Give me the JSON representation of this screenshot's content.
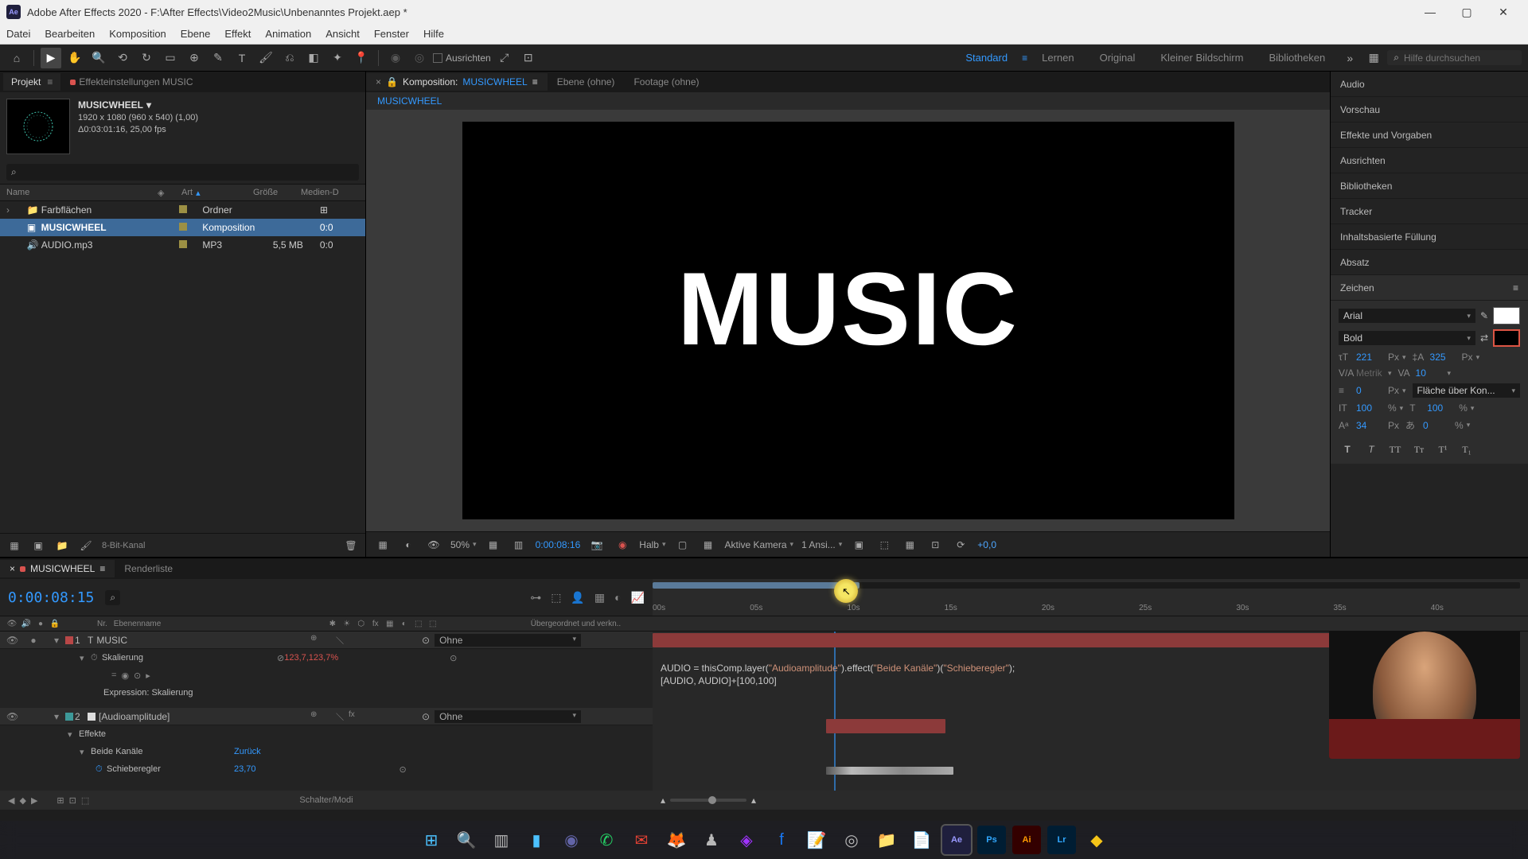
{
  "titlebar": {
    "title": "Adobe After Effects 2020 - F:\\After Effects\\Video2Music\\Unbenanntes Projekt.aep *"
  },
  "menubar": [
    "Datei",
    "Bearbeiten",
    "Komposition",
    "Ebene",
    "Effekt",
    "Animation",
    "Ansicht",
    "Fenster",
    "Hilfe"
  ],
  "toolbar": {
    "align_label": "Ausrichten",
    "workspaces": [
      "Standard",
      "Lernen",
      "Original",
      "Kleiner Bildschirm",
      "Bibliotheken"
    ],
    "search_placeholder": "Hilfe durchsuchen"
  },
  "project_panel": {
    "tab_project": "Projekt",
    "tab_effect": "Effekteinstellungen MUSIC",
    "comp_name": "MUSICWHEEL",
    "dims": "1920 x 1080 (960 x 540) (1,00)",
    "duration": "Δ0:03:01:16, 25,00 fps",
    "headers": {
      "name": "Name",
      "art": "Art",
      "size": "Größe",
      "media": "Medien-D"
    },
    "rows": [
      {
        "name": "Farbflächen",
        "art": "Ordner",
        "size": "",
        "media": "",
        "folder": true
      },
      {
        "name": "MUSICWHEEL",
        "art": "Komposition",
        "size": "",
        "media": "0:0",
        "selected": true
      },
      {
        "name": "AUDIO.mp3",
        "art": "MP3",
        "size": "5,5 MB",
        "media": "0:0"
      }
    ],
    "depth": "8-Bit-Kanal"
  },
  "composition": {
    "tab_label": "Komposition:",
    "tab_name": "MUSICWHEEL",
    "tab_layer": "Ebene (ohne)",
    "tab_footage": "Footage (ohne)",
    "breadcrumb": "MUSICWHEEL",
    "display_text": "MUSIC",
    "footer": {
      "zoom": "50%",
      "timecode": "0:00:08:16",
      "resolution": "Halb",
      "camera": "Aktive Kamera",
      "views": "1 Ansi...",
      "exposure": "+0,0"
    }
  },
  "right_panel": {
    "tabs": [
      "Audio",
      "Vorschau",
      "Effekte und Vorgaben",
      "Ausrichten",
      "Bibliotheken",
      "Tracker",
      "Inhaltsbasierte Füllung",
      "Absatz"
    ],
    "active_tab": "Zeichen",
    "font": "Arial",
    "weight": "Bold",
    "font_size": "221",
    "leading": "325",
    "kerning": "Metrik",
    "tracking": "10",
    "stroke": "0",
    "stroke_unit": "Px",
    "stroke_mode": "Fläche über Kon...",
    "vscale": "100",
    "hscale": "100",
    "baseline": "34",
    "tsume": "0",
    "px": "Px",
    "pct": "%"
  },
  "timeline": {
    "tab_name": "MUSICWHEEL",
    "tab_render": "Renderliste",
    "timecode": "0:00:08:15",
    "ruler": [
      "00s",
      "05s",
      "10s",
      "15s",
      "20s",
      "25s",
      "30s",
      "35s",
      "40s"
    ],
    "col_nr": "Nr.",
    "col_layer": "Ebenenname",
    "col_parent": "Übergeordnet und verkn..",
    "layers": [
      {
        "nr": "1",
        "name": "MUSIC",
        "parent": "Ohne",
        "color": "red"
      },
      {
        "nr": "2",
        "name": "[Audioamplitude]",
        "parent": "Ohne",
        "color": "teal"
      }
    ],
    "prop_scale": "Skalierung",
    "scale_value": "123,7,123,7",
    "scale_unit": "%",
    "expr_label": "Expression: Skalierung",
    "effects_label": "Effekte",
    "bc_label": "Beide Kanäle",
    "bc_reset": "Zurück",
    "slider_label": "Schieberegler",
    "slider_value": "23,70",
    "expr_line1a": "AUDIO = thisComp.layer(",
    "expr_line1b": "\"Audioamplitude\"",
    "expr_line1c": ").effect(",
    "expr_line1d": "\"Beide Kanäle\"",
    "expr_line1e": ")(",
    "expr_line1f": "\"Schieberegler\"",
    "expr_line1g": ");",
    "expr_line2": "[AUDIO, AUDIO]+[100,100]",
    "footer_label": "Schalter/Modi"
  }
}
